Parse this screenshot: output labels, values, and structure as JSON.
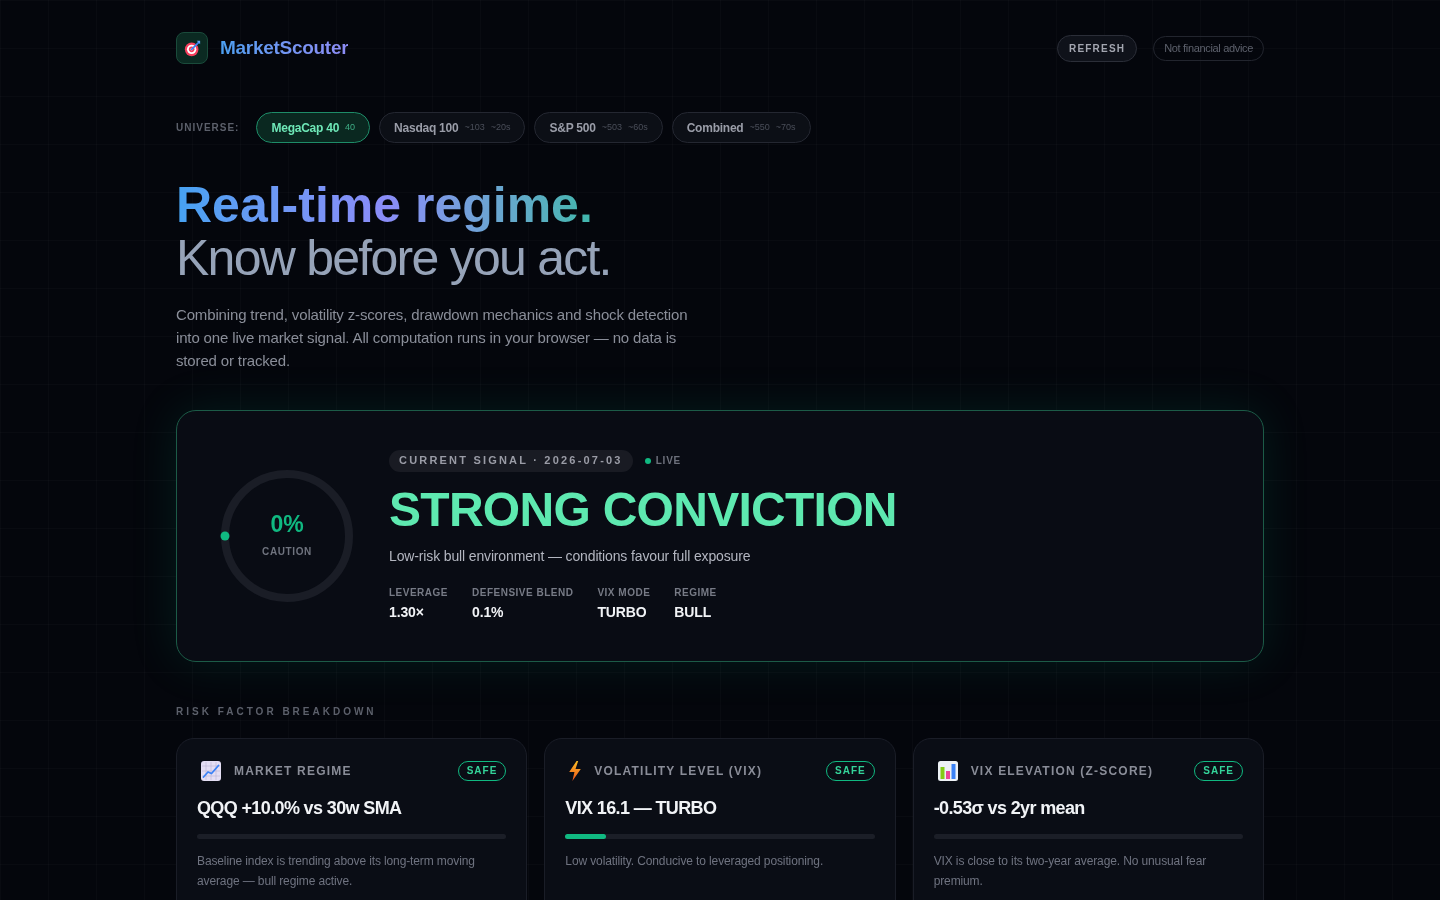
{
  "header": {
    "brand": "MarketScouter",
    "buttons": [
      {
        "label": "REFRESH",
        "kind": "action"
      },
      {
        "label": "Not financial advice",
        "kind": "notice"
      }
    ]
  },
  "universe": {
    "label": "UNIVERSE:",
    "options": [
      {
        "label": "MegaCap 40",
        "meta": [
          "40"
        ],
        "selected": true
      },
      {
        "label": "Nasdaq 100",
        "meta": [
          "~103",
          "~20s"
        ],
        "selected": false
      },
      {
        "label": "S&P 500",
        "meta": [
          "~503",
          "~60s"
        ],
        "selected": false
      },
      {
        "label": "Combined",
        "meta": [
          "~550",
          "~70s"
        ],
        "selected": false
      }
    ]
  },
  "hero": {
    "title": "Real-time regime.",
    "subtitle": "Know before you act.",
    "description": "Combining trend, volatility z-scores, drawdown mechanics and shock detection into one live market signal. All computation runs in your browser — no data is stored or tracked."
  },
  "signal": {
    "gauge": {
      "level": 0,
      "value": "0%",
      "label": "CAUTION"
    },
    "tag": "CURRENT SIGNAL · 2026-07-03",
    "live": "LIVE",
    "title": "STRONG CONVICTION",
    "summary": "Low-risk bull environment — conditions favour full exposure",
    "stats": [
      {
        "label": "LEVERAGE",
        "value": "1.30×"
      },
      {
        "label": "DEFENSIVE BLEND",
        "value": "0.1%"
      },
      {
        "label": "VIX MODE",
        "value": "TURBO"
      },
      {
        "label": "REGIME",
        "value": "BULL"
      }
    ]
  },
  "breakdown": {
    "title": "RISK FACTOR BREAKDOWN",
    "factors": [
      {
        "kind": "trend",
        "title": "MARKET REGIME",
        "status": "SAFE",
        "value": "QQQ +10.0% vs 30w SMA",
        "description": "Baseline index is trending above its long-term moving average — bull regime active."
      },
      {
        "kind": "volatility",
        "title": "VOLATILITY LEVEL (VIX)",
        "status": "SAFE",
        "value": "VIX 16.1 — TURBO",
        "level": 0.13,
        "description": "Low volatility. Conducive to leveraged positioning."
      },
      {
        "kind": "zscore",
        "title": "VIX ELEVATION (Z-SCORE)",
        "status": "SAFE",
        "value": "-0.53σ vs 2yr mean",
        "description": "VIX is close to its two-year average. No unusual fear premium."
      }
    ]
  }
}
